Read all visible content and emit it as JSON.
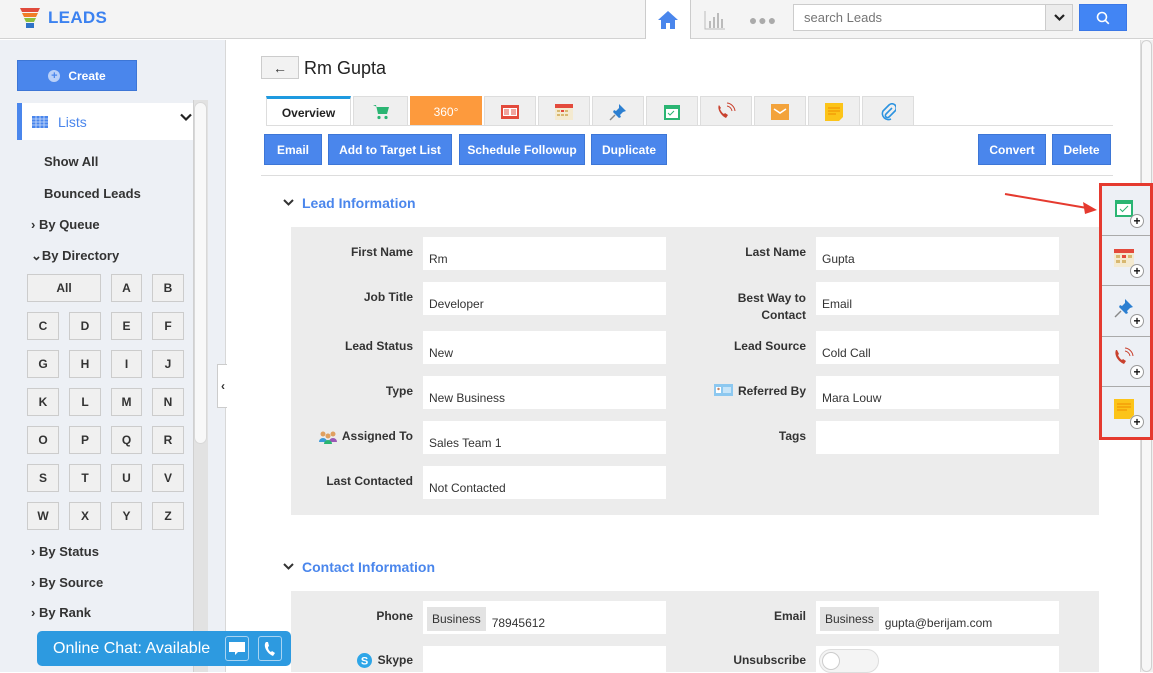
{
  "app": {
    "title": "LEADS"
  },
  "topbar": {
    "search_placeholder": "search Leads",
    "more_label": "●●●"
  },
  "sidebar": {
    "create_label": "Create",
    "lists_label": "Lists",
    "links": [
      "Show All",
      "Bounced Leads"
    ],
    "groups": [
      {
        "label": "By Queue",
        "expanded": false
      },
      {
        "label": "By Directory",
        "expanded": true
      },
      {
        "label": "By Status",
        "expanded": false
      },
      {
        "label": "By Source",
        "expanded": false
      },
      {
        "label": "By Rank",
        "expanded": false
      }
    ],
    "directory": [
      "All",
      "A",
      "B",
      "C",
      "D",
      "E",
      "F",
      "G",
      "H",
      "I",
      "J",
      "K",
      "L",
      "M",
      "N",
      "O",
      "P",
      "Q",
      "R",
      "S",
      "T",
      "U",
      "V",
      "W",
      "X",
      "Y",
      "Z"
    ]
  },
  "chat": {
    "label": "Online Chat: Available"
  },
  "record": {
    "title": "Rm Gupta",
    "tabs": [
      {
        "label": "Overview",
        "icon": "overview",
        "active": true
      },
      {
        "label": "",
        "icon": "cart-icon"
      },
      {
        "label": "360°",
        "icon": "360-icon"
      },
      {
        "label": "",
        "icon": "news-icon"
      },
      {
        "label": "",
        "icon": "calendar-icon"
      },
      {
        "label": "",
        "icon": "pin-icon"
      },
      {
        "label": "",
        "icon": "task-icon"
      },
      {
        "label": "",
        "icon": "call-icon"
      },
      {
        "label": "",
        "icon": "mail-icon"
      },
      {
        "label": "",
        "icon": "note-icon"
      },
      {
        "label": "",
        "icon": "attachment-icon"
      }
    ],
    "actions": {
      "email": "Email",
      "add_target": "Add to Target List",
      "schedule": "Schedule Followup",
      "duplicate": "Duplicate",
      "convert": "Convert",
      "delete": "Delete"
    }
  },
  "lead_info": {
    "title": "Lead Information",
    "left": [
      {
        "label": "First Name",
        "value": "Rm"
      },
      {
        "label": "Job Title",
        "value": "Developer"
      },
      {
        "label": "Lead Status",
        "value": "New"
      },
      {
        "label": "Type",
        "value": "New Business"
      },
      {
        "label": "Assigned To",
        "value": "Sales Team 1"
      },
      {
        "label": "Last Contacted",
        "value": "Not Contacted"
      }
    ],
    "right": [
      {
        "label": "Last Name",
        "value": "Gupta"
      },
      {
        "label": "Best Way to Contact",
        "value": "Email"
      },
      {
        "label": "Lead Source",
        "value": "Cold Call"
      },
      {
        "label": "Referred By",
        "value": "Mara Louw"
      },
      {
        "label": "Tags",
        "value": ""
      }
    ]
  },
  "contact_info": {
    "title": "Contact Information",
    "phone": {
      "label": "Phone",
      "type": "Business",
      "value": "78945612"
    },
    "email": {
      "label": "Email",
      "type": "Business",
      "value": "gupta@berijam.com"
    },
    "skype": {
      "label": "Skype",
      "value": ""
    },
    "unsubscribe": {
      "label": "Unsubscribe",
      "on": false
    }
  },
  "quick_add": [
    "add-task",
    "add-event",
    "add-pin",
    "add-call",
    "add-note"
  ],
  "colors": {
    "accent": "#4a86ec",
    "highlight": "#e53a2f",
    "tab_360": "#fd9a3d"
  }
}
